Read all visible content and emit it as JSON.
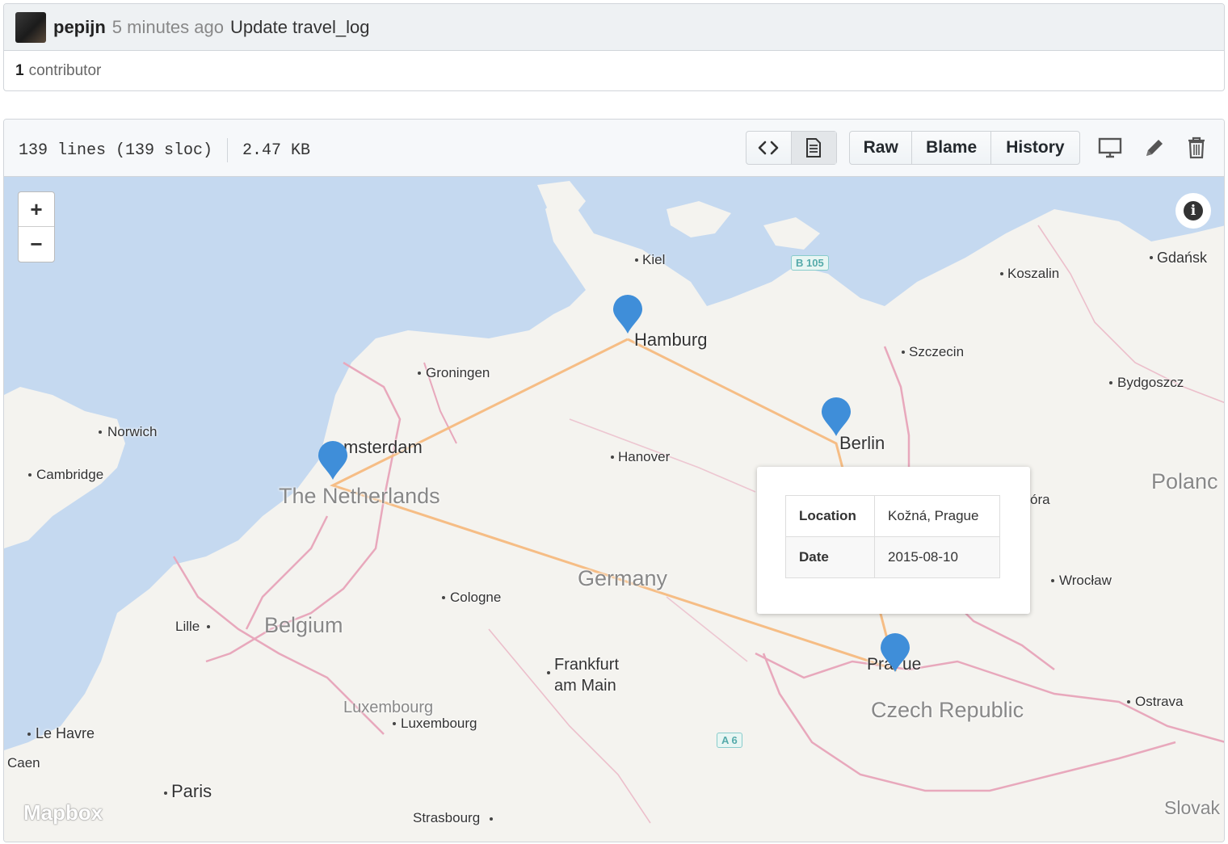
{
  "commit": {
    "author": "pepijn",
    "time_ago": "5 minutes ago",
    "message": "Update travel_log",
    "contributor_count": "1",
    "contributor_label": "contributor"
  },
  "file": {
    "lines": "139 lines (139 sloc)",
    "size": "2.47 KB",
    "buttons": {
      "raw": "Raw",
      "blame": "Blame",
      "history": "History"
    }
  },
  "map": {
    "zoom_in": "+",
    "zoom_out": "−",
    "attribution": "Mapbox",
    "cities": [
      {
        "name": "Kiel"
      },
      {
        "name": "Hamburg"
      },
      {
        "name": "Groningen"
      },
      {
        "name": "Norwich"
      },
      {
        "name": "Cambridge"
      },
      {
        "name": "msterdam"
      },
      {
        "name": "Hanover"
      },
      {
        "name": "Berlin"
      },
      {
        "name": "Szczecin"
      },
      {
        "name": "Koszalin"
      },
      {
        "name": "Gdańsk"
      },
      {
        "name": "Bydgoszcz"
      },
      {
        "name": "Cologne"
      },
      {
        "name": "Lille"
      },
      {
        "name": "Frankfurt"
      },
      {
        "name": "am Main"
      },
      {
        "name": "Luxembourg"
      },
      {
        "name": "Le Havre"
      },
      {
        "name": "Caen"
      },
      {
        "name": "Paris"
      },
      {
        "name": "Strasbourg"
      },
      {
        "name": "Wrocław"
      },
      {
        "name": "Ostrava"
      },
      {
        "name": "óra"
      },
      {
        "name": "Pra"
      },
      {
        "name": "ue"
      }
    ],
    "countries": [
      "The Netherlands",
      "Germany",
      "Belgium",
      "Luxembourg",
      "Czech Republic",
      "Polanc",
      "Slovak"
    ],
    "road_shields": [
      "B 105",
      "A 6"
    ],
    "popup": {
      "rows": [
        {
          "key": "Location",
          "value": "Kožná, Prague"
        },
        {
          "key": "Date",
          "value": "2015-08-10"
        }
      ]
    }
  }
}
